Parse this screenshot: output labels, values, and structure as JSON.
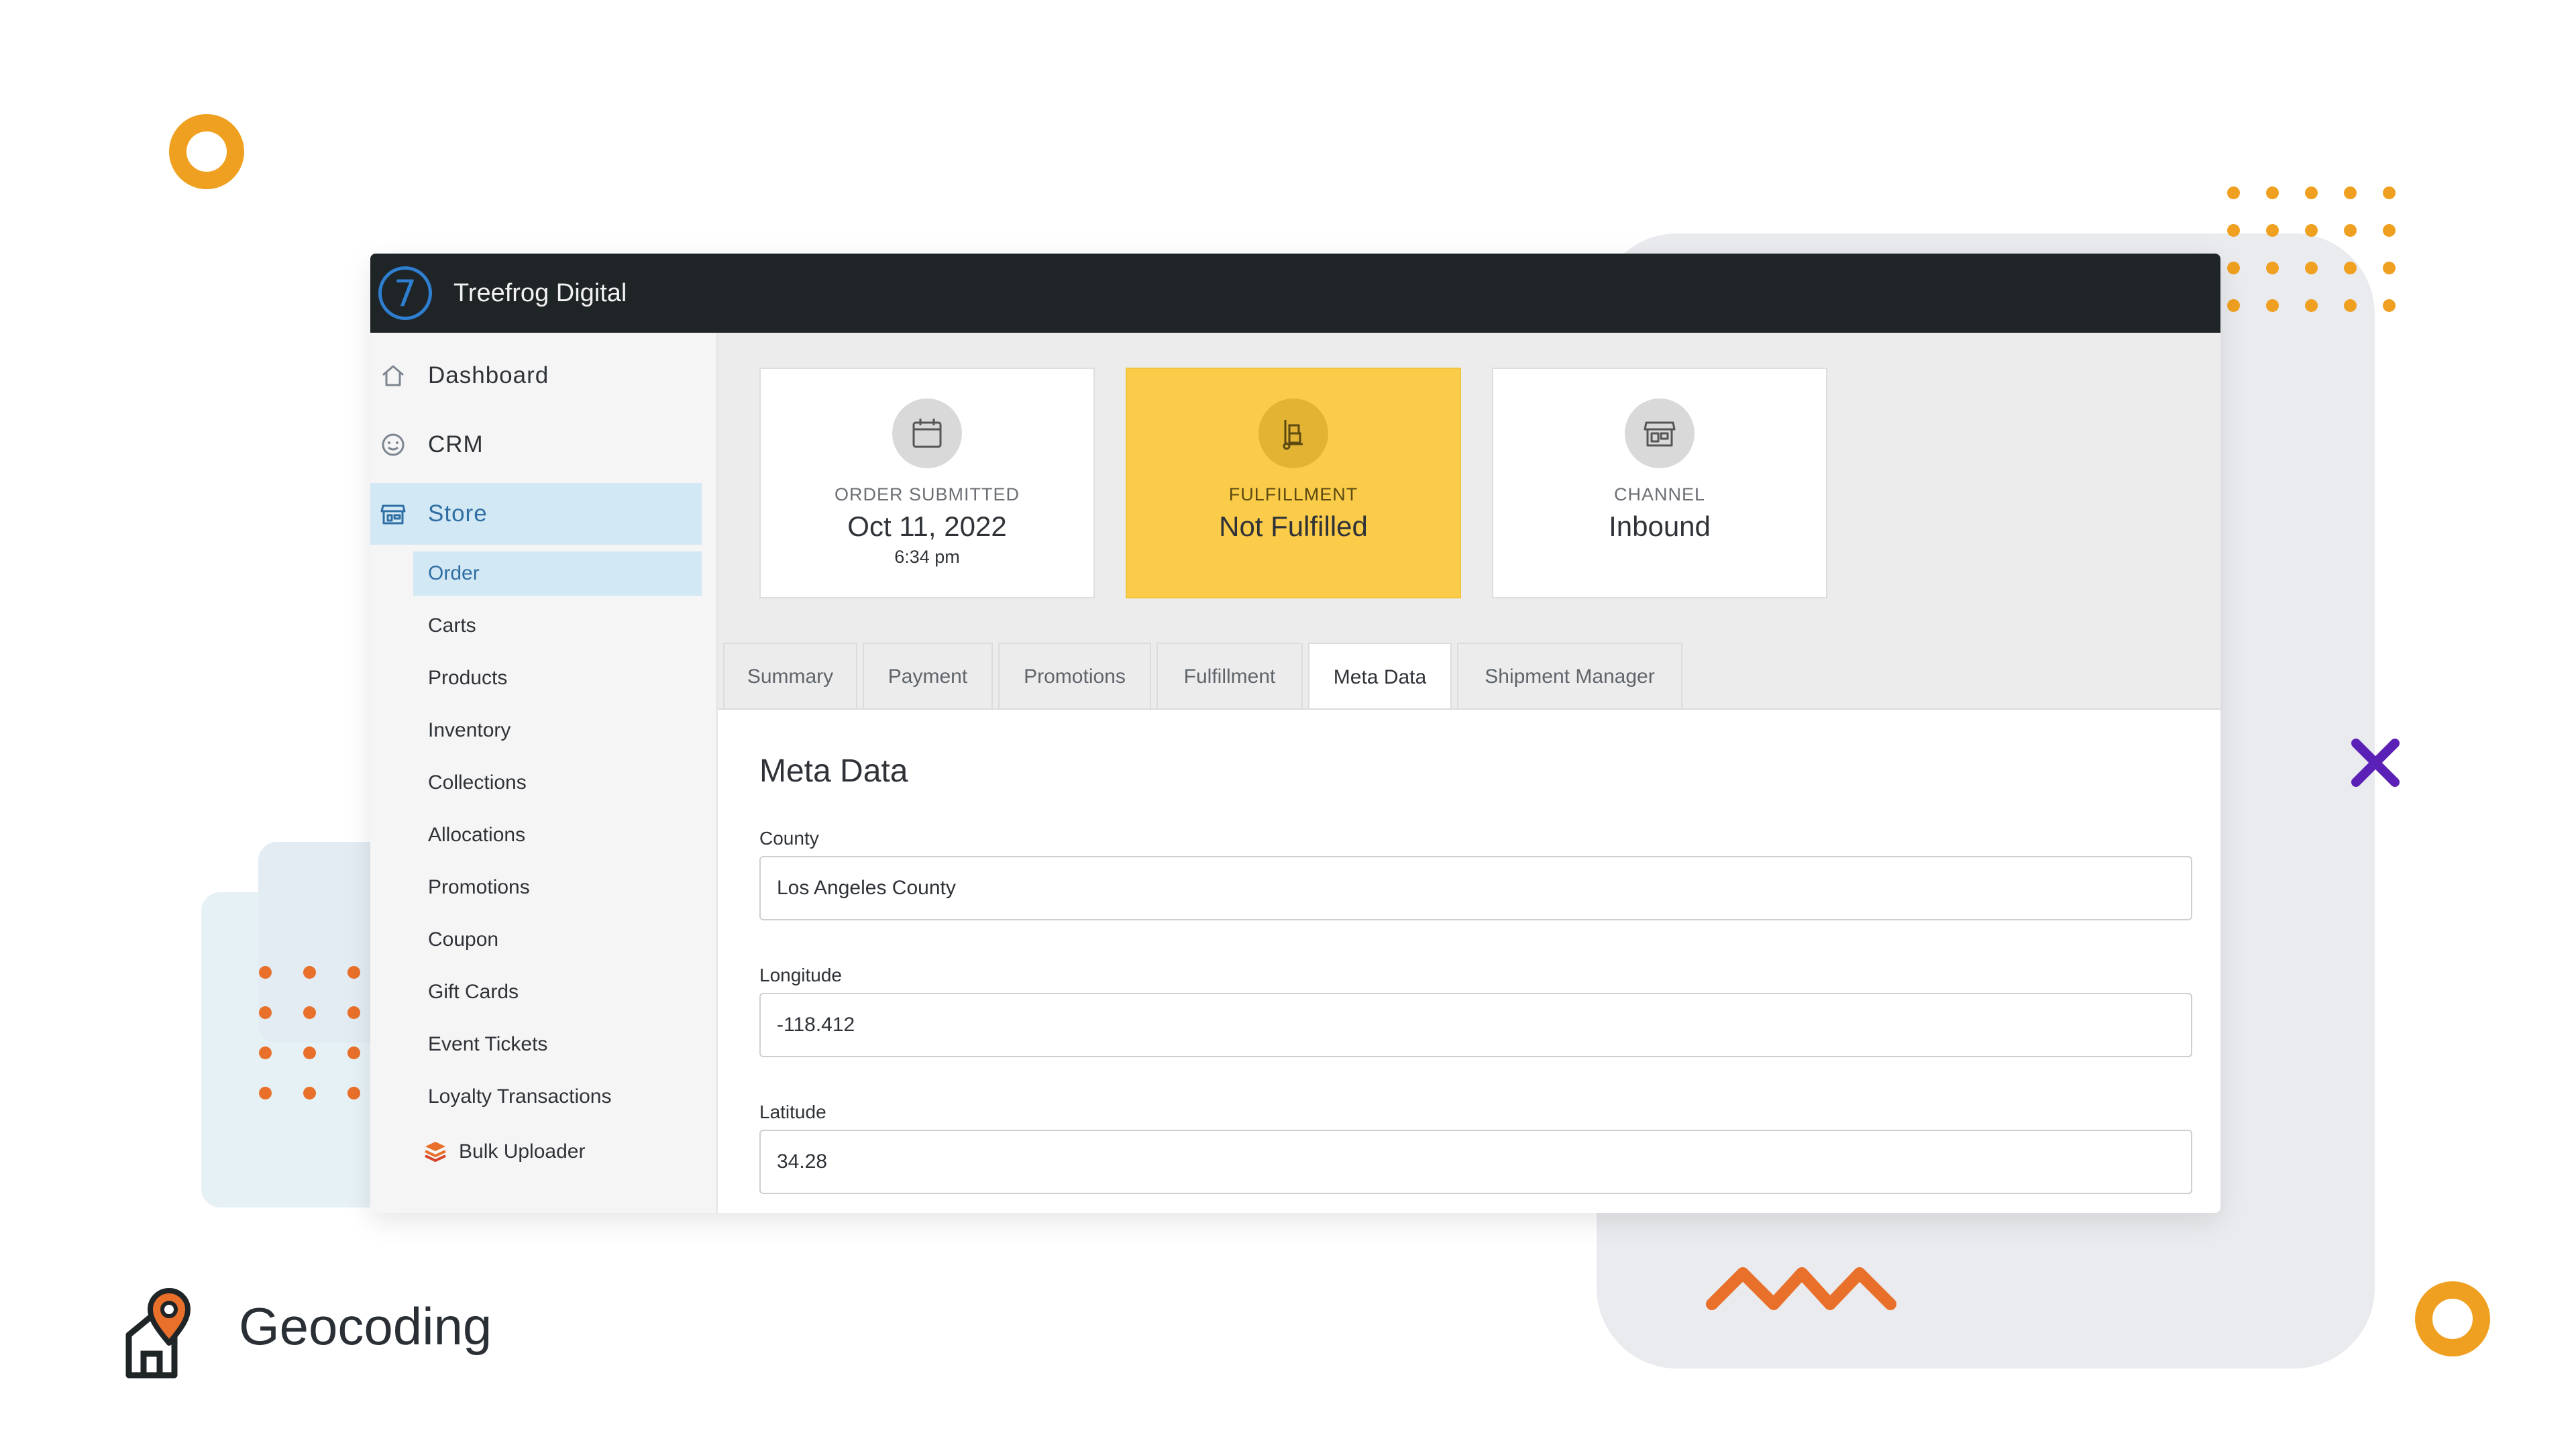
{
  "app": {
    "title": "Treefrog Digital"
  },
  "sidebar": {
    "main": [
      {
        "label": "Dashboard",
        "icon": "home-icon"
      },
      {
        "label": "CRM",
        "icon": "smiley-icon"
      },
      {
        "label": "Store",
        "icon": "storefront-icon",
        "active": true
      }
    ],
    "sub": [
      {
        "label": "Order",
        "active": true
      },
      {
        "label": "Carts"
      },
      {
        "label": "Products"
      },
      {
        "label": "Inventory"
      },
      {
        "label": "Collections"
      },
      {
        "label": "Allocations"
      },
      {
        "label": "Promotions"
      },
      {
        "label": "Coupon"
      },
      {
        "label": "Gift Cards"
      },
      {
        "label": "Event Tickets"
      },
      {
        "label": "Loyalty Transactions"
      },
      {
        "label": "Bulk Uploader",
        "icon": "layers-icon"
      }
    ]
  },
  "cards": [
    {
      "label": "ORDER SUBMITTED",
      "value": "Oct 11, 2022",
      "sub": "6:34 pm",
      "icon": "calendar-icon"
    },
    {
      "label": "FULFILLMENT",
      "value": "Not Fulfilled",
      "icon": "hand-truck-icon",
      "highlight": "#fbcc4a"
    },
    {
      "label": "CHANNEL",
      "value": "Inbound",
      "icon": "store-icon"
    }
  ],
  "tabs": [
    {
      "label": "Summary"
    },
    {
      "label": "Payment"
    },
    {
      "label": "Promotions"
    },
    {
      "label": "Fulfillment"
    },
    {
      "label": "Meta Data",
      "active": true
    },
    {
      "label": "Shipment Manager"
    }
  ],
  "meta": {
    "title": "Meta Data",
    "fields": [
      {
        "label": "County",
        "value": "Los Angeles County"
      },
      {
        "label": "Longitude",
        "value": "-118.412"
      },
      {
        "label": "Latitude",
        "value": "34.28"
      }
    ]
  },
  "footer": {
    "title": "Geocoding",
    "icon": "location-house-icon"
  },
  "colors": {
    "accent": "#2f7fd0",
    "highlight": "#fbcc4a",
    "orange": "#f0a020",
    "purple": "#5b21b6",
    "coral": "#e8702a"
  }
}
